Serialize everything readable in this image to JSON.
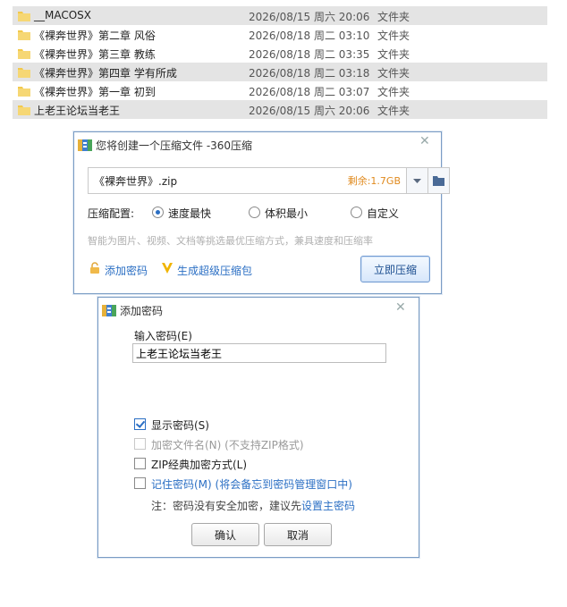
{
  "files": [
    {
      "name": "__MACOSX",
      "date": "2026/08/15 周六 20:06",
      "type": "文件夹"
    },
    {
      "name": "《裸奔世界》第二章 风俗",
      "date": "2026/08/18 周二 03:10",
      "type": "文件夹"
    },
    {
      "name": "《裸奔世界》第三章 教练",
      "date": "2026/08/18 周二 03:35",
      "type": "文件夹"
    },
    {
      "name": "《裸奔世界》第四章 学有所成",
      "date": "2026/08/18 周二 03:18",
      "type": "文件夹"
    },
    {
      "name": "《裸奔世界》第一章 初到",
      "date": "2026/08/18 周二 03:07",
      "type": "文件夹"
    },
    {
      "name": "上老王论坛当老王",
      "date": "2026/08/15 周六 20:06",
      "type": "文件夹"
    }
  ],
  "compress_dialog": {
    "title": "您将创建一个压缩文件 -360压缩",
    "filename": "《裸奔世界》.zip",
    "remaining": "剩余:1.7GB",
    "config_label": "压缩配置:",
    "options": [
      {
        "label": "速度最快",
        "selected": true
      },
      {
        "label": "体积最小",
        "selected": false
      },
      {
        "label": "自定义",
        "selected": false
      }
    ],
    "hint": "智能为图片、视频、文档等挑选最优压缩方式，兼具速度和压缩率",
    "add_password": "添加密码",
    "super_compress": "生成超级压缩包",
    "compress_now": "立即压缩"
  },
  "password_dialog": {
    "title": "添加密码",
    "input_label": "输入密码(E)",
    "password_value": "上老王论坛当老王",
    "show_password": "显示密码(S)",
    "show_password_checked": true,
    "encrypt_filenames": "加密文件名(N) (不支持ZIP格式)",
    "zip_classic": "ZIP经典加密方式(L)",
    "remember_password": "记住密码(M) (将会备忘到密码管理窗口中)",
    "note_prefix": "注：密码没有安全加密，建议先",
    "note_link": "设置主密码",
    "ok": "确认",
    "cancel": "取消"
  },
  "colors": {
    "accent": "#2b6fc4",
    "remaining": "#e08a1e",
    "folder": "#f2c94c",
    "shaded_row": "#e4e4e4"
  }
}
